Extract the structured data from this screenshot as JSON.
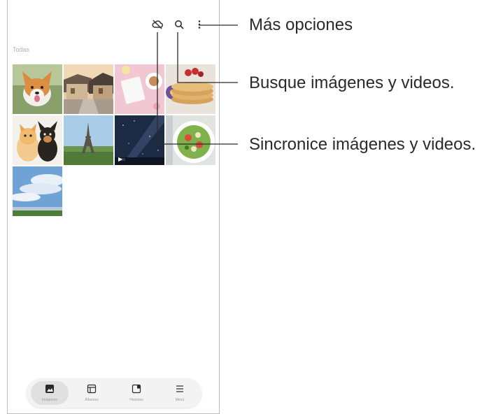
{
  "gallery": {
    "section_label": "Todas",
    "video_badge": "▶",
    "thumbnails": [
      {
        "name": "corgi-photo",
        "icon": "dog"
      },
      {
        "name": "village-photo",
        "icon": "houses"
      },
      {
        "name": "desk-photo",
        "icon": "notebook-coffee"
      },
      {
        "name": "pancakes-photo",
        "icon": "pancakes"
      },
      {
        "name": "pets-photo",
        "icon": "cat-dog"
      },
      {
        "name": "eiffel-photo",
        "icon": "tower"
      },
      {
        "name": "night-sky-video",
        "icon": "milky-way"
      },
      {
        "name": "salad-photo",
        "icon": "salad"
      },
      {
        "name": "sky-photo",
        "icon": "clouds"
      }
    ]
  },
  "toolbar": {
    "icons": [
      "cloud-off-icon",
      "search-icon",
      "more-options-icon"
    ]
  },
  "bottom_nav": {
    "items": [
      {
        "label": "Imágenes",
        "icon": "picture-icon",
        "active": true
      },
      {
        "label": "Álbumes",
        "icon": "album-icon",
        "active": false
      },
      {
        "label": "Historias",
        "icon": "stories-icon",
        "active": false
      },
      {
        "label": "Menú",
        "icon": "menu-icon",
        "active": false
      }
    ]
  },
  "callouts": {
    "more_options": "Más opciones",
    "search": "Busque imágenes y videos.",
    "sync": "Sincronice imágenes y videos."
  },
  "colors": {
    "leader_line": "#2a2a2a",
    "nav_background": "#f3f3f3",
    "active_pill": "#e0e0e0"
  }
}
